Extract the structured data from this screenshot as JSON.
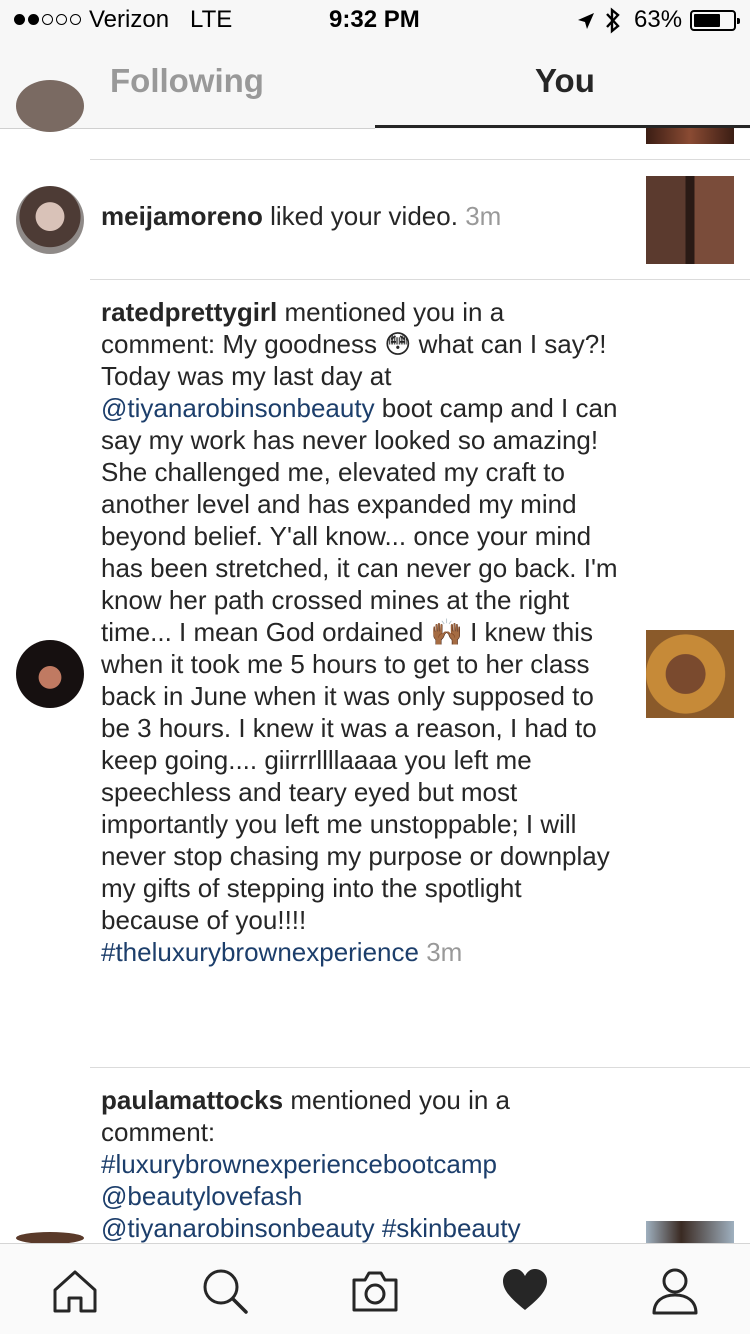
{
  "status_bar": {
    "carrier": "Verizon",
    "network": "LTE",
    "time": "9:32 PM",
    "battery": "63%",
    "signal_dots_filled": 2,
    "signal_dots_total": 5
  },
  "tabs": {
    "following": "Following",
    "you": "You",
    "active": "You"
  },
  "notifications": [
    {
      "user": "meijamoreno",
      "text": "liked your video.",
      "time": "3m"
    },
    {
      "user": "ratedprettygirl",
      "parts": [
        {
          "t": "mentioned you in a comment: My goodness ",
          "link": false
        },
        {
          "t": "😳",
          "emoji": true
        },
        {
          "t": "  what can I say?! Today was my last day at ",
          "link": false
        },
        {
          "t": "@tiyanarobinsonbeauty",
          "link": true
        },
        {
          "t": " boot camp and I can say my work has never looked so amazing! She challenged me, elevated my craft to another level and has expanded my mind beyond belief. Y'all know... once your mind has been stretched, it can never go back. I'm know her path crossed mines at the right time... I mean God ordained ",
          "link": false
        },
        {
          "t": "🙌🏾",
          "emoji": true
        },
        {
          "t": " I knew this when it took me 5 hours to get to her class back in June when it was only supposed to be 3 hours. I knew it was a reason, I had to keep going.... giirrrllllaaaa you left me speechless and teary eyed but most importantly you left me unstoppable; I will never stop chasing my purpose  or downplay my gifts of stepping into the spotlight because of you!!!! ",
          "link": false
        },
        {
          "t": "#theluxurybrownexperience",
          "link": true
        }
      ],
      "time": "3m"
    },
    {
      "user": "paulamattocks",
      "text": "mentioned you in a comment:",
      "tags": [
        "#luxurybrownexperiencebootcamp",
        "@beautylovefash",
        "@tiyanarobinsonbeauty",
        "#skinbeauty"
      ]
    }
  ],
  "nav": [
    "home-icon",
    "search-icon",
    "camera-icon",
    "heart-icon",
    "profile-icon"
  ],
  "colors": {
    "link": "#1c3e6b",
    "muted": "#999999",
    "text": "#262626"
  }
}
